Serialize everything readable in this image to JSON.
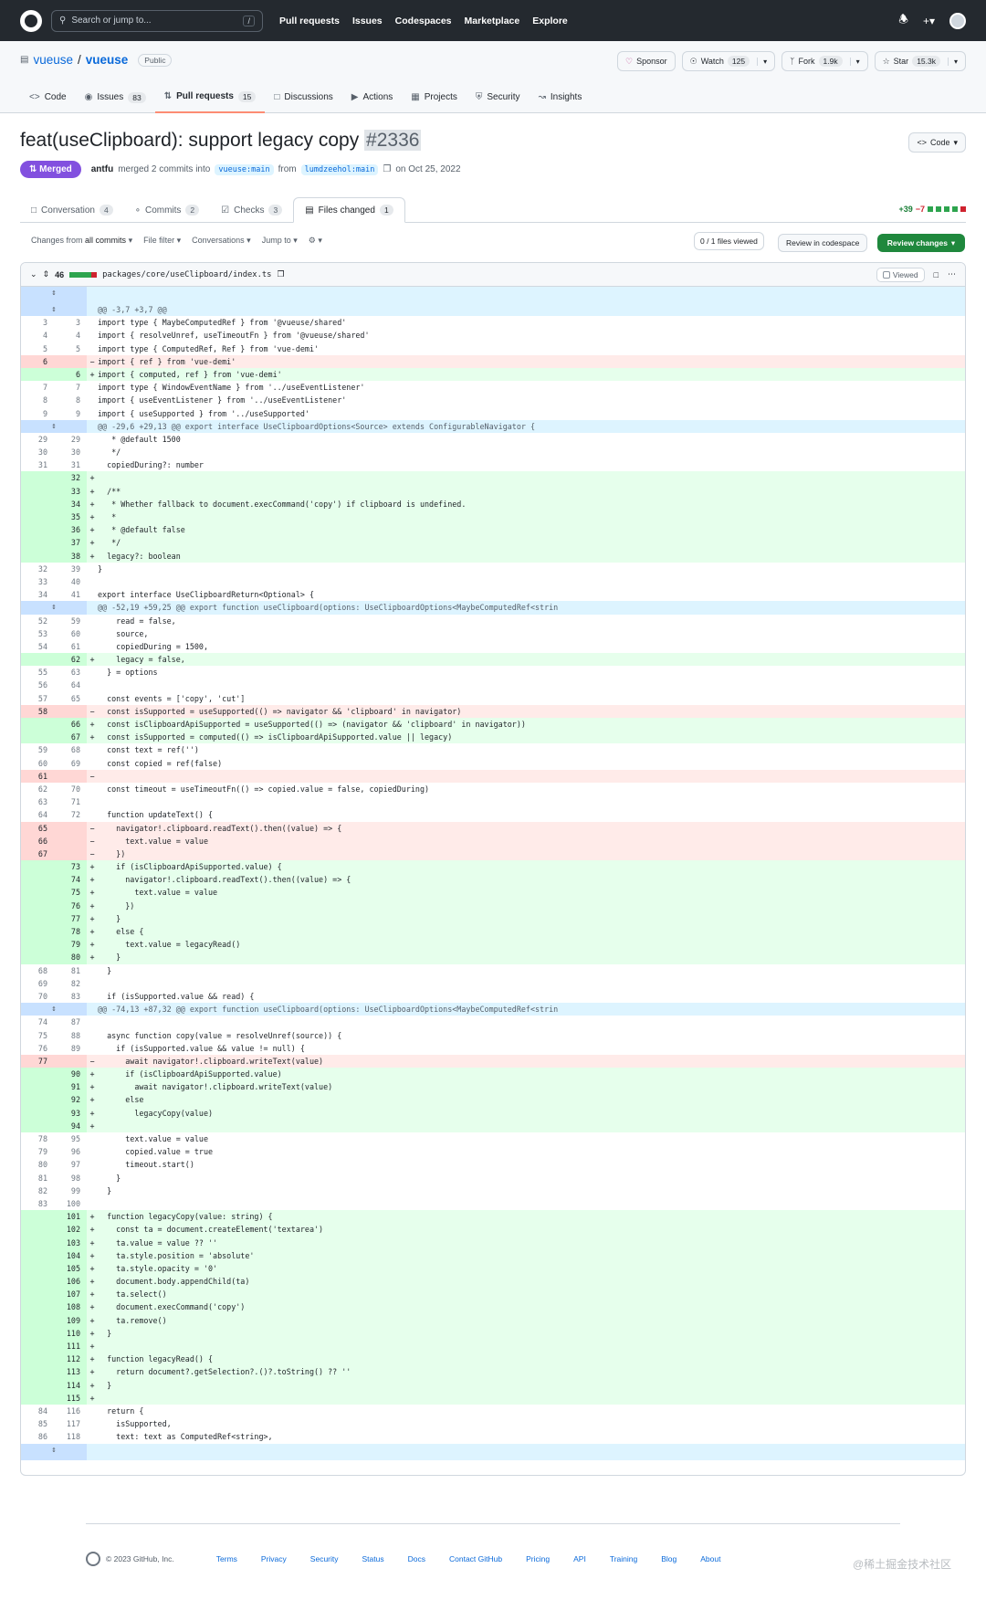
{
  "header": {
    "search_placeholder": "Search or jump to...",
    "search_shortcut": "/",
    "nav": [
      "Pull requests",
      "Issues",
      "Codespaces",
      "Marketplace",
      "Explore"
    ]
  },
  "repo": {
    "owner": "vueuse",
    "separator": "/",
    "name": "vueuse",
    "visibility": "Public",
    "sponsor": "Sponsor",
    "watch": "Watch",
    "watch_count": "125",
    "fork": "Fork",
    "fork_count": "1.9k",
    "star": "Star",
    "star_count": "15.3k",
    "tabs": [
      {
        "label": "Code",
        "count": ""
      },
      {
        "label": "Issues",
        "count": "83"
      },
      {
        "label": "Pull requests",
        "count": "15"
      },
      {
        "label": "Discussions",
        "count": ""
      },
      {
        "label": "Actions",
        "count": ""
      },
      {
        "label": "Projects",
        "count": ""
      },
      {
        "label": "Security",
        "count": ""
      },
      {
        "label": "Insights",
        "count": ""
      }
    ]
  },
  "pr": {
    "title": "feat(useClipboard): support legacy copy",
    "number": "#2336",
    "code_button": "Code",
    "status": "Merged",
    "author": "antfu",
    "merged_text": "merged 2 commits into",
    "base_branch": "vueuse:main",
    "from_text": "from",
    "head_branch": "lumdzeehol:main",
    "date_text": "on Oct 25, 2022",
    "tabs": [
      {
        "label": "Conversation",
        "count": "4"
      },
      {
        "label": "Commits",
        "count": "2"
      },
      {
        "label": "Checks",
        "count": "3"
      },
      {
        "label": "Files changed",
        "count": "1"
      }
    ],
    "additions": "+39",
    "deletions": "−7"
  },
  "toolbar": {
    "changes_from_prefix": "Changes from",
    "changes_from_value": "all commits",
    "file_filter": "File filter",
    "conversations": "Conversations",
    "jump_to": "Jump to",
    "files_viewed": "0 / 1 files viewed",
    "review_codespace": "Review in codespace",
    "review_changes": "Review changes"
  },
  "file": {
    "changes": "46",
    "path": "packages/core/useClipboard/index.ts",
    "viewed_label": "Viewed"
  },
  "diff_lines": [
    {
      "t": "expand"
    },
    {
      "t": "hunk",
      "c": "@@ -3,7 +3,7 @@"
    },
    {
      "t": "ctx",
      "o": "3",
      "n": "3",
      "c": "import type { MaybeComputedRef } from '@vueuse/shared'"
    },
    {
      "t": "ctx",
      "o": "4",
      "n": "4",
      "c": "import { resolveUnref, useTimeoutFn } from '@vueuse/shared'"
    },
    {
      "t": "ctx",
      "o": "5",
      "n": "5",
      "c": "import type { ComputedRef, Ref } from 'vue-demi'"
    },
    {
      "t": "del",
      "o": "6",
      "n": "",
      "c": "import { ref } from 'vue-demi'"
    },
    {
      "t": "add",
      "o": "",
      "n": "6",
      "c": "import { computed, ref } from 'vue-demi'"
    },
    {
      "t": "ctx",
      "o": "7",
      "n": "7",
      "c": "import type { WindowEventName } from '../useEventListener'"
    },
    {
      "t": "ctx",
      "o": "8",
      "n": "8",
      "c": "import { useEventListener } from '../useEventListener'"
    },
    {
      "t": "ctx",
      "o": "9",
      "n": "9",
      "c": "import { useSupported } from '../useSupported'"
    },
    {
      "t": "hunk",
      "c": "@@ -29,6 +29,13 @@ export interface UseClipboardOptions<Source> extends ConfigurableNavigator {"
    },
    {
      "t": "ctx",
      "o": "29",
      "n": "29",
      "c": "   * @default 1500"
    },
    {
      "t": "ctx",
      "o": "30",
      "n": "30",
      "c": "   */"
    },
    {
      "t": "ctx",
      "o": "31",
      "n": "31",
      "c": "  copiedDuring?: number"
    },
    {
      "t": "add",
      "o": "",
      "n": "32",
      "c": ""
    },
    {
      "t": "add",
      "o": "",
      "n": "33",
      "c": "  /**"
    },
    {
      "t": "add",
      "o": "",
      "n": "34",
      "c": "   * Whether fallback to document.execCommand('copy') if clipboard is undefined."
    },
    {
      "t": "add",
      "o": "",
      "n": "35",
      "c": "   *"
    },
    {
      "t": "add",
      "o": "",
      "n": "36",
      "c": "   * @default false"
    },
    {
      "t": "add",
      "o": "",
      "n": "37",
      "c": "   */"
    },
    {
      "t": "add",
      "o": "",
      "n": "38",
      "c": "  legacy?: boolean"
    },
    {
      "t": "ctx",
      "o": "32",
      "n": "39",
      "c": "}"
    },
    {
      "t": "ctx",
      "o": "33",
      "n": "40",
      "c": ""
    },
    {
      "t": "ctx",
      "o": "34",
      "n": "41",
      "c": "export interface UseClipboardReturn<Optional> {"
    },
    {
      "t": "hunk",
      "c": "@@ -52,19 +59,25 @@ export function useClipboard(options: UseClipboardOptions<MaybeComputedRef<strin"
    },
    {
      "t": "ctx",
      "o": "52",
      "n": "59",
      "c": "    read = false,"
    },
    {
      "t": "ctx",
      "o": "53",
      "n": "60",
      "c": "    source,"
    },
    {
      "t": "ctx",
      "o": "54",
      "n": "61",
      "c": "    copiedDuring = 1500,"
    },
    {
      "t": "add",
      "o": "",
      "n": "62",
      "c": "    legacy = false,"
    },
    {
      "t": "ctx",
      "o": "55",
      "n": "63",
      "c": "  } = options"
    },
    {
      "t": "ctx",
      "o": "56",
      "n": "64",
      "c": ""
    },
    {
      "t": "ctx",
      "o": "57",
      "n": "65",
      "c": "  const events = ['copy', 'cut']"
    },
    {
      "t": "del",
      "o": "58",
      "n": "",
      "c": "  const isSupported = useSupported(() => navigator && 'clipboard' in navigator)"
    },
    {
      "t": "add",
      "o": "",
      "n": "66",
      "c": "  const isClipboardApiSupported = useSupported(() => (navigator && 'clipboard' in navigator))"
    },
    {
      "t": "add",
      "o": "",
      "n": "67",
      "c": "  const isSupported = computed(() => isClipboardApiSupported.value || legacy)"
    },
    {
      "t": "ctx",
      "o": "59",
      "n": "68",
      "c": "  const text = ref('')"
    },
    {
      "t": "ctx",
      "o": "60",
      "n": "69",
      "c": "  const copied = ref(false)"
    },
    {
      "t": "del",
      "o": "61",
      "n": "",
      "c": ""
    },
    {
      "t": "ctx",
      "o": "62",
      "n": "70",
      "c": "  const timeout = useTimeoutFn(() => copied.value = false, copiedDuring)"
    },
    {
      "t": "ctx",
      "o": "63",
      "n": "71",
      "c": ""
    },
    {
      "t": "ctx",
      "o": "64",
      "n": "72",
      "c": "  function updateText() {"
    },
    {
      "t": "del",
      "o": "65",
      "n": "",
      "c": "    navigator!.clipboard.readText().then((value) => {"
    },
    {
      "t": "del",
      "o": "66",
      "n": "",
      "c": "      text.value = value"
    },
    {
      "t": "del",
      "o": "67",
      "n": "",
      "c": "    })"
    },
    {
      "t": "add",
      "o": "",
      "n": "73",
      "c": "    if (isClipboardApiSupported.value) {"
    },
    {
      "t": "add",
      "o": "",
      "n": "74",
      "c": "      navigator!.clipboard.readText().then((value) => {"
    },
    {
      "t": "add",
      "o": "",
      "n": "75",
      "c": "        text.value = value"
    },
    {
      "t": "add",
      "o": "",
      "n": "76",
      "c": "      })"
    },
    {
      "t": "add",
      "o": "",
      "n": "77",
      "c": "    }"
    },
    {
      "t": "add",
      "o": "",
      "n": "78",
      "c": "    else {"
    },
    {
      "t": "add",
      "o": "",
      "n": "79",
      "c": "      text.value = legacyRead()"
    },
    {
      "t": "add",
      "o": "",
      "n": "80",
      "c": "    }"
    },
    {
      "t": "ctx",
      "o": "68",
      "n": "81",
      "c": "  }"
    },
    {
      "t": "ctx",
      "o": "69",
      "n": "82",
      "c": ""
    },
    {
      "t": "ctx",
      "o": "70",
      "n": "83",
      "c": "  if (isSupported.value && read) {"
    },
    {
      "t": "hunk",
      "c": "@@ -74,13 +87,32 @@ export function useClipboard(options: UseClipboardOptions<MaybeComputedRef<strin"
    },
    {
      "t": "ctx",
      "o": "74",
      "n": "87",
      "c": ""
    },
    {
      "t": "ctx",
      "o": "75",
      "n": "88",
      "c": "  async function copy(value = resolveUnref(source)) {"
    },
    {
      "t": "ctx",
      "o": "76",
      "n": "89",
      "c": "    if (isSupported.value && value != null) {"
    },
    {
      "t": "del",
      "o": "77",
      "n": "",
      "c": "      await navigator!.clipboard.writeText(value)"
    },
    {
      "t": "add",
      "o": "",
      "n": "90",
      "c": "      if (isClipboardApiSupported.value)"
    },
    {
      "t": "add",
      "o": "",
      "n": "91",
      "c": "        await navigator!.clipboard.writeText(value)"
    },
    {
      "t": "add",
      "o": "",
      "n": "92",
      "c": "      else"
    },
    {
      "t": "add",
      "o": "",
      "n": "93",
      "c": "        legacyCopy(value)"
    },
    {
      "t": "add",
      "o": "",
      "n": "94",
      "c": ""
    },
    {
      "t": "ctx",
      "o": "78",
      "n": "95",
      "c": "      text.value = value"
    },
    {
      "t": "ctx",
      "o": "79",
      "n": "96",
      "c": "      copied.value = true"
    },
    {
      "t": "ctx",
      "o": "80",
      "n": "97",
      "c": "      timeout.start()"
    },
    {
      "t": "ctx",
      "o": "81",
      "n": "98",
      "c": "    }"
    },
    {
      "t": "ctx",
      "o": "82",
      "n": "99",
      "c": "  }"
    },
    {
      "t": "ctx",
      "o": "83",
      "n": "100",
      "c": ""
    },
    {
      "t": "add",
      "o": "",
      "n": "101",
      "c": "  function legacyCopy(value: string) {"
    },
    {
      "t": "add",
      "o": "",
      "n": "102",
      "c": "    const ta = document.createElement('textarea')"
    },
    {
      "t": "add",
      "o": "",
      "n": "103",
      "c": "    ta.value = value ?? ''"
    },
    {
      "t": "add",
      "o": "",
      "n": "104",
      "c": "    ta.style.position = 'absolute'"
    },
    {
      "t": "add",
      "o": "",
      "n": "105",
      "c": "    ta.style.opacity = '0'"
    },
    {
      "t": "add",
      "o": "",
      "n": "106",
      "c": "    document.body.appendChild(ta)"
    },
    {
      "t": "add",
      "o": "",
      "n": "107",
      "c": "    ta.select()"
    },
    {
      "t": "add",
      "o": "",
      "n": "108",
      "c": "    document.execCommand('copy')"
    },
    {
      "t": "add",
      "o": "",
      "n": "109",
      "c": "    ta.remove()"
    },
    {
      "t": "add",
      "o": "",
      "n": "110",
      "c": "  }"
    },
    {
      "t": "add",
      "o": "",
      "n": "111",
      "c": ""
    },
    {
      "t": "add",
      "o": "",
      "n": "112",
      "c": "  function legacyRead() {"
    },
    {
      "t": "add",
      "o": "",
      "n": "113",
      "c": "    return document?.getSelection?.()?.toString() ?? ''"
    },
    {
      "t": "add",
      "o": "",
      "n": "114",
      "c": "  }"
    },
    {
      "t": "add",
      "o": "",
      "n": "115",
      "c": ""
    },
    {
      "t": "ctx",
      "o": "84",
      "n": "116",
      "c": "  return {"
    },
    {
      "t": "ctx",
      "o": "85",
      "n": "117",
      "c": "    isSupported,"
    },
    {
      "t": "ctx",
      "o": "86",
      "n": "118",
      "c": "    text: text as ComputedRef<string>,"
    },
    {
      "t": "expand"
    }
  ],
  "footer": {
    "copyright": "© 2023 GitHub, Inc.",
    "links": [
      "Terms",
      "Privacy",
      "Security",
      "Status",
      "Docs",
      "Contact GitHub",
      "Pricing",
      "API",
      "Training",
      "Blog",
      "About"
    ],
    "watermark": "@稀土掘金技术社区"
  },
  "colors": {
    "header_bg": "#24292f",
    "merged": "#8250df",
    "add_bg": "#e6ffec",
    "del_bg": "#ffebe9",
    "hunk_bg": "#ddf4ff",
    "primary_button": "#1f883d",
    "link": "#0969da"
  }
}
